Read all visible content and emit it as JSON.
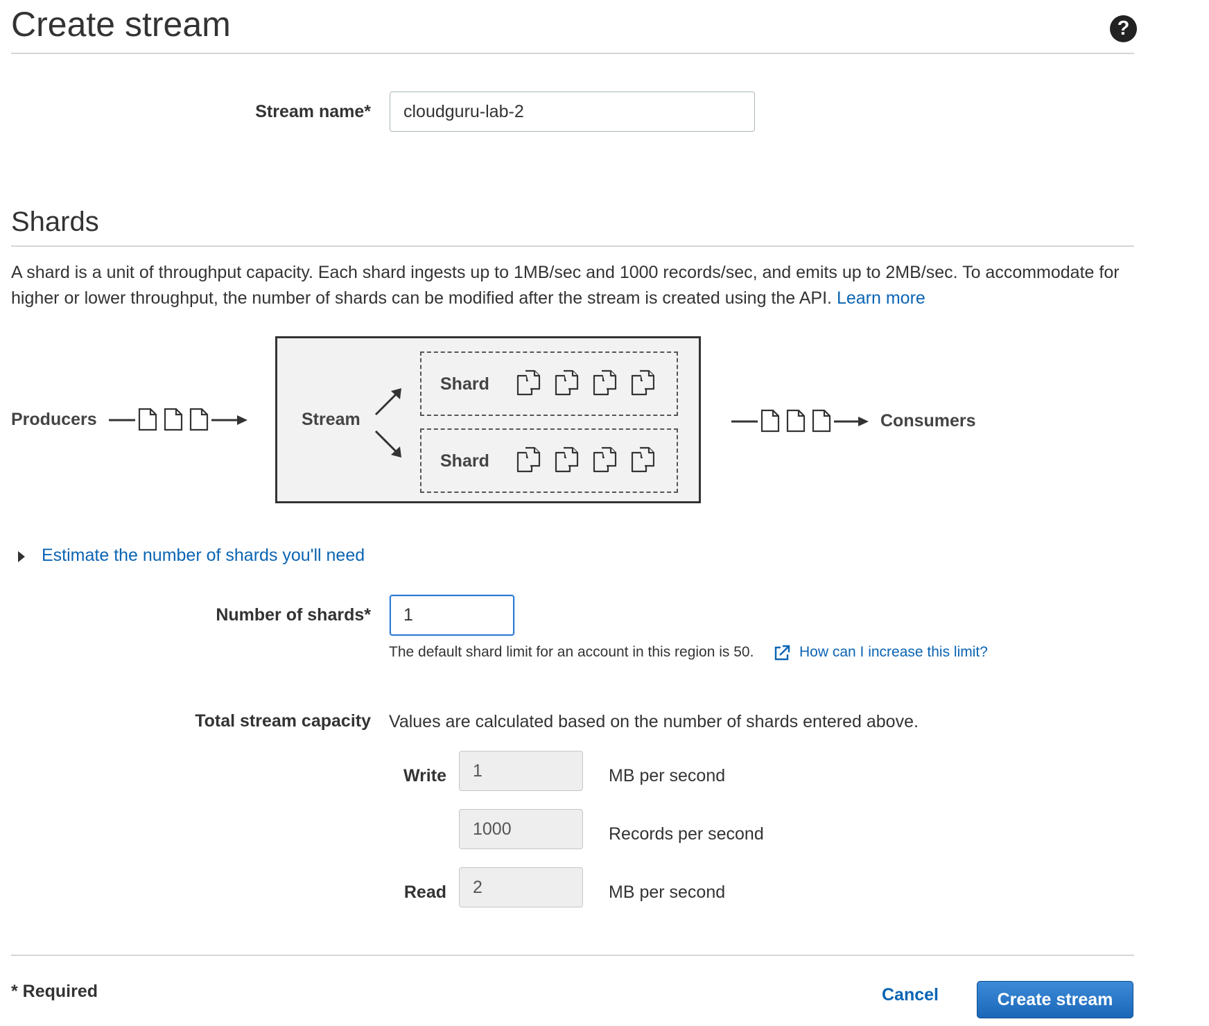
{
  "header": {
    "title": "Create stream",
    "help_icon": "question-circle-icon"
  },
  "stream_name": {
    "label": "Stream name*",
    "value": "cloudguru-lab-2"
  },
  "shards_section": {
    "title": "Shards",
    "description": "A shard is a unit of throughput capacity. Each shard ingests up to 1MB/sec and 1000 records/sec, and emits up to 2MB/sec. To accommodate for higher or lower throughput, the number of shards can be modified after the stream is created using the API.",
    "learn_more": "Learn more"
  },
  "diagram": {
    "producers": "Producers",
    "stream": "Stream",
    "shard_top": "Shard",
    "shard_bottom": "Shard",
    "consumers": "Consumers"
  },
  "estimate_link": "Estimate the number of shards you'll need",
  "number_of_shards": {
    "label": "Number of shards*",
    "value": "1",
    "hint": "The default shard limit for an account in this region is 50.",
    "hint_link": "How can I increase this limit?"
  },
  "capacity": {
    "label": "Total stream capacity",
    "description": "Values are calculated based on the number of shards entered above.",
    "write_label": "Write",
    "write_mb_value": "1",
    "write_mb_unit": "MB per second",
    "write_records_value": "1000",
    "write_records_unit": "Records per second",
    "read_label": "Read",
    "read_mb_value": "2",
    "read_mb_unit": "MB per second"
  },
  "footer": {
    "required_note": "* Required",
    "cancel": "Cancel",
    "create": "Create stream"
  },
  "colors": {
    "link": "#0a64b3",
    "primary_button": "#1a67b8",
    "focus_border": "#2b7bd3"
  }
}
